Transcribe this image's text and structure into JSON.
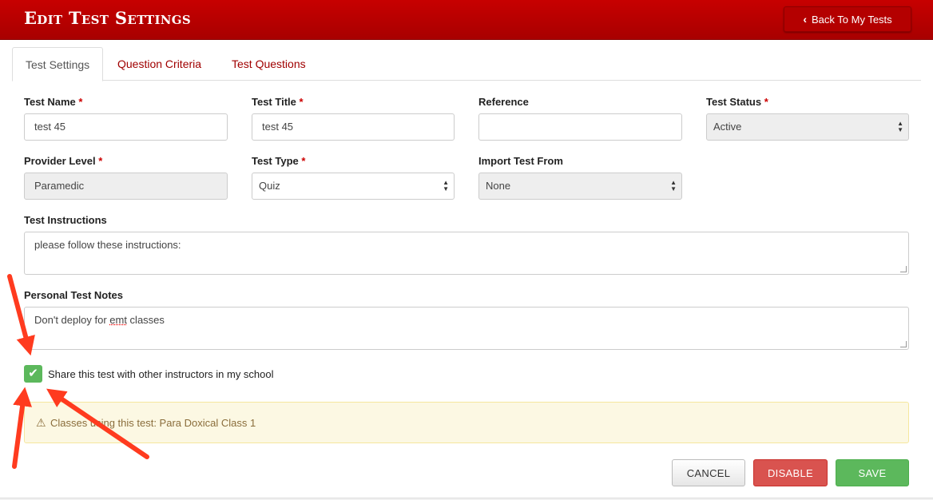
{
  "header": {
    "title": "Edit Test Settings",
    "back_label": "Back To My Tests"
  },
  "tabs": [
    {
      "label": "Test Settings",
      "active": true
    },
    {
      "label": "Question Criteria",
      "active": false
    },
    {
      "label": "Test Questions",
      "active": false
    }
  ],
  "form": {
    "test_name": {
      "label": "Test Name",
      "value": "test 45"
    },
    "test_title": {
      "label": "Test Title",
      "value": "test 45"
    },
    "reference": {
      "label": "Reference",
      "value": ""
    },
    "test_status": {
      "label": "Test Status",
      "value": "Active"
    },
    "provider_level": {
      "label": "Provider Level",
      "value": "Paramedic"
    },
    "test_type": {
      "label": "Test Type",
      "value": "Quiz"
    },
    "import_from": {
      "label": "Import Test From",
      "value": "None"
    },
    "instructions": {
      "label": "Test Instructions",
      "value": "please follow these instructions:"
    },
    "notes": {
      "label": "Personal Test Notes",
      "value_before": "Don't deploy for ",
      "value_misspelled": "emt",
      "value_after": " classes"
    },
    "required_marker": "*"
  },
  "share": {
    "label": "Share this test with other instructors in my school",
    "checked": true
  },
  "warning": {
    "text": "Classes using this test: Para Doxical Class 1",
    "icon": "warning-triangle-icon"
  },
  "buttons": {
    "cancel": "CANCEL",
    "disable": "DISABLE",
    "save": "SAVE"
  },
  "colors": {
    "header": "#c70000",
    "tab_link": "#a00000",
    "success": "#5cb85c",
    "danger": "#d9534f",
    "annotation_arrow": "#ff3b1f"
  }
}
